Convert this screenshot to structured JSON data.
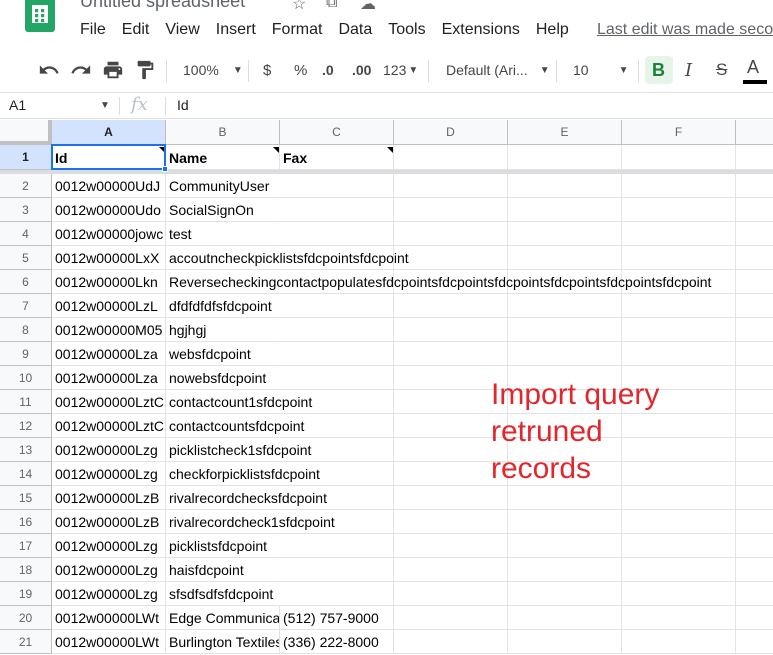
{
  "app": {
    "title": "Untitled spreadsheet",
    "brand_color": "#23a566"
  },
  "menu": {
    "items": [
      "File",
      "Edit",
      "View",
      "Insert",
      "Format",
      "Data",
      "Tools",
      "Extensions",
      "Help"
    ],
    "last_edit": "Last edit was made seconds ago"
  },
  "toolbar": {
    "zoom": "100%",
    "currency": "$",
    "percent": "%",
    "decrease_decimal": ".0",
    "increase_decimal": ".00",
    "number_format": "123",
    "font": "Default (Ari...",
    "font_size": "10",
    "bold": "B",
    "italic": "I",
    "strikethrough": "S",
    "text_color": "A",
    "icons": [
      "undo-icon",
      "redo-icon",
      "print-icon",
      "paint-format-icon"
    ]
  },
  "formula_bar": {
    "name_box": "A1",
    "fx": "fx",
    "value": "Id"
  },
  "grid": {
    "columns": [
      "A",
      "B",
      "C",
      "D",
      "E",
      "F"
    ],
    "rows": [
      {
        "num": "1",
        "cells": [
          "Id",
          "Name",
          "Fax"
        ]
      },
      {
        "num": "2",
        "cells": [
          "0012w00000UdJ",
          "CommunityUser",
          ""
        ]
      },
      {
        "num": "3",
        "cells": [
          "0012w00000Udo",
          "SocialSignOn",
          ""
        ]
      },
      {
        "num": "4",
        "cells": [
          "0012w00000jowc",
          "test",
          ""
        ]
      },
      {
        "num": "5",
        "cells": [
          "0012w00000LxX",
          "accoutncheckpicklistsfdcpointsfdcpoint",
          ""
        ]
      },
      {
        "num": "6",
        "cells": [
          "0012w00000Lkn",
          "Reversecheckingcontactpopulatesfdcpointsfdcpointsfdcpointsfdcpointsfdcpointsfdcpoint",
          ""
        ]
      },
      {
        "num": "7",
        "cells": [
          "0012w00000LzL",
          "dfdfdfdfsfdcpoint",
          ""
        ]
      },
      {
        "num": "8",
        "cells": [
          "0012w00000M05",
          "hgjhgj",
          ""
        ]
      },
      {
        "num": "9",
        "cells": [
          "0012w00000Lza",
          "websfdcpoint",
          ""
        ]
      },
      {
        "num": "10",
        "cells": [
          "0012w00000Lza",
          "nowebsfdcpoint",
          ""
        ]
      },
      {
        "num": "11",
        "cells": [
          "0012w00000LztC",
          "contactcount1sfdcpoint",
          ""
        ]
      },
      {
        "num": "12",
        "cells": [
          "0012w00000LztC",
          "contactcountsfdcpoint",
          ""
        ]
      },
      {
        "num": "13",
        "cells": [
          "0012w00000Lzg",
          "picklistcheck1sfdcpoint",
          ""
        ]
      },
      {
        "num": "14",
        "cells": [
          "0012w00000Lzg",
          "checkforpicklistsfdcpoint",
          ""
        ]
      },
      {
        "num": "15",
        "cells": [
          "0012w00000LzB",
          "rivalrecordchecksfdcpoint",
          ""
        ]
      },
      {
        "num": "16",
        "cells": [
          "0012w00000LzB",
          "rivalrecordcheck1sfdcpoint",
          ""
        ]
      },
      {
        "num": "17",
        "cells": [
          "0012w00000Lzg",
          "picklistsfdcpoint",
          ""
        ]
      },
      {
        "num": "18",
        "cells": [
          "0012w00000Lzg",
          "haisfdcpoint",
          ""
        ]
      },
      {
        "num": "19",
        "cells": [
          "0012w00000Lzg",
          "sfsdfsdfsfdcpoint",
          ""
        ]
      },
      {
        "num": "20",
        "cells": [
          "0012w00000LWt",
          "Edge Communications",
          "(512) 757-9000"
        ]
      },
      {
        "num": "21",
        "cells": [
          "0012w00000LWt",
          "Burlington Textiles",
          "(336) 222-8000"
        ]
      }
    ]
  },
  "annotation": {
    "text": "Import query\nretruned\nrecords",
    "color": "#e3262b"
  }
}
